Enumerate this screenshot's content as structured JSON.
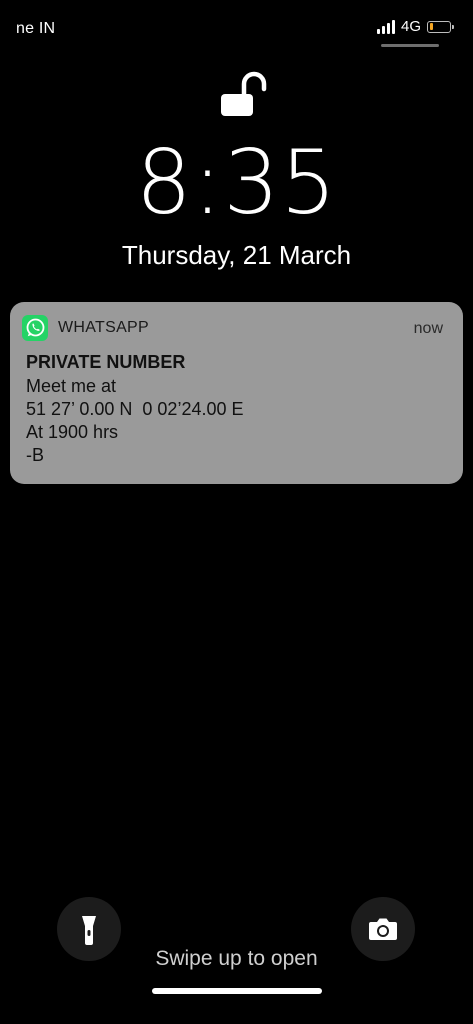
{
  "status_bar": {
    "carrier": "ne IN",
    "network": "4G",
    "battery_level": 0.15,
    "battery_color": "#f5a623",
    "signal_bars": 4
  },
  "lock_screen": {
    "lock_state": "unlocked",
    "time": "8:35",
    "date": "Thursday, 21 March"
  },
  "notification": {
    "app_name": "WHATSAPP",
    "app_icon": "whatsapp-icon",
    "app_color": "#25D366",
    "time": "now",
    "title": "PRIVATE NUMBER",
    "body": [
      "Meet me at",
      "51 27’ 0.00 N  0 02’24.00 E",
      "At 1900 hrs",
      "-B"
    ]
  },
  "bottom": {
    "flashlight_icon": "flashlight-icon",
    "camera_icon": "camera-icon",
    "swipe_hint": "Swipe up to open"
  }
}
